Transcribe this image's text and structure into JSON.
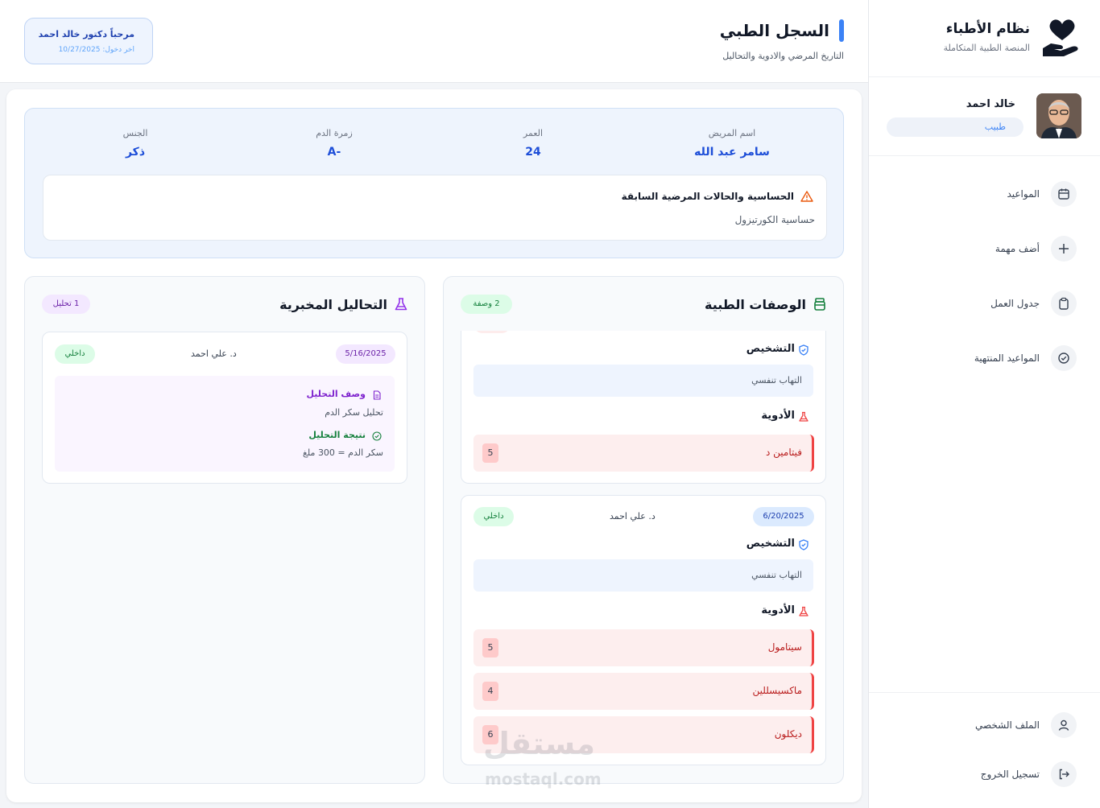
{
  "brand": {
    "title": "نظام الأطباء",
    "subtitle": "المنصة الطبية المتكاملة"
  },
  "user": {
    "name": "خالد احمد",
    "role": "طبيب"
  },
  "nav": [
    {
      "label": "المواعيد",
      "icon": "calendar-icon"
    },
    {
      "label": "أضف مهمة",
      "icon": "plus-icon"
    },
    {
      "label": "جدول العمل",
      "icon": "clipboard-icon"
    },
    {
      "label": "المواعيد المنتهية",
      "icon": "check-circle-icon"
    }
  ],
  "nav_bottom": [
    {
      "label": "الملف الشخصي",
      "icon": "user-icon"
    },
    {
      "label": "تسجيل الخروج",
      "icon": "logout-icon"
    }
  ],
  "header": {
    "title": "السجل الطبي",
    "subtitle": "التاريخ المرضي والادوية والتحاليل",
    "welcome": "مرحباً دكتور خالد احمد",
    "last_login": "اخر دخول: 10/27/2025"
  },
  "patient": {
    "name_label": "اسم المريض",
    "name": "سامر عبد الله",
    "age_label": "العمر",
    "age": "24",
    "blood_label": "زمرة الدم",
    "blood": "A-",
    "gender_label": "الجنس",
    "gender": "ذكر",
    "allergy_title": "الحساسية والحالات المرضية السابقة",
    "allergy_value": "حساسية الكورتيزول"
  },
  "prescriptions": {
    "title": "الوصفات الطبية",
    "count": "2 وصفة",
    "diagnosis_label": "التشخيص",
    "meds_label": "الأدوية",
    "items": [
      {
        "diagnosis": "التهاب تنفسي",
        "meds": [
          {
            "name": "فيتامين د",
            "qty": "5"
          }
        ]
      },
      {
        "date": "6/20/2025",
        "doctor": "د. علي احمد",
        "type": "داخلي",
        "diagnosis": "التهاب تنفسي",
        "meds": [
          {
            "name": "سيتامول",
            "qty": "5"
          },
          {
            "name": "ماكسيسللين",
            "qty": "4"
          },
          {
            "name": "ديكلون",
            "qty": "6"
          }
        ]
      }
    ]
  },
  "labs": {
    "title": "التحاليل المخبرية",
    "count": "1 تحليل",
    "items": [
      {
        "date": "5/16/2025",
        "doctor": "د. علي احمد",
        "type": "داخلي",
        "desc_label": "وصف التحليل",
        "desc": "تحليل سكر الدم",
        "result_label": "نتيجة التحليل",
        "result": "سكر الدم = 300 ملغ"
      }
    ]
  },
  "watermark": {
    "ar": "مستقل",
    "en": "mostaql.com"
  },
  "colors": {
    "accent": "#3b82f6",
    "danger": "#ef4444",
    "success": "#15803d",
    "lab": "#7e22ce"
  }
}
